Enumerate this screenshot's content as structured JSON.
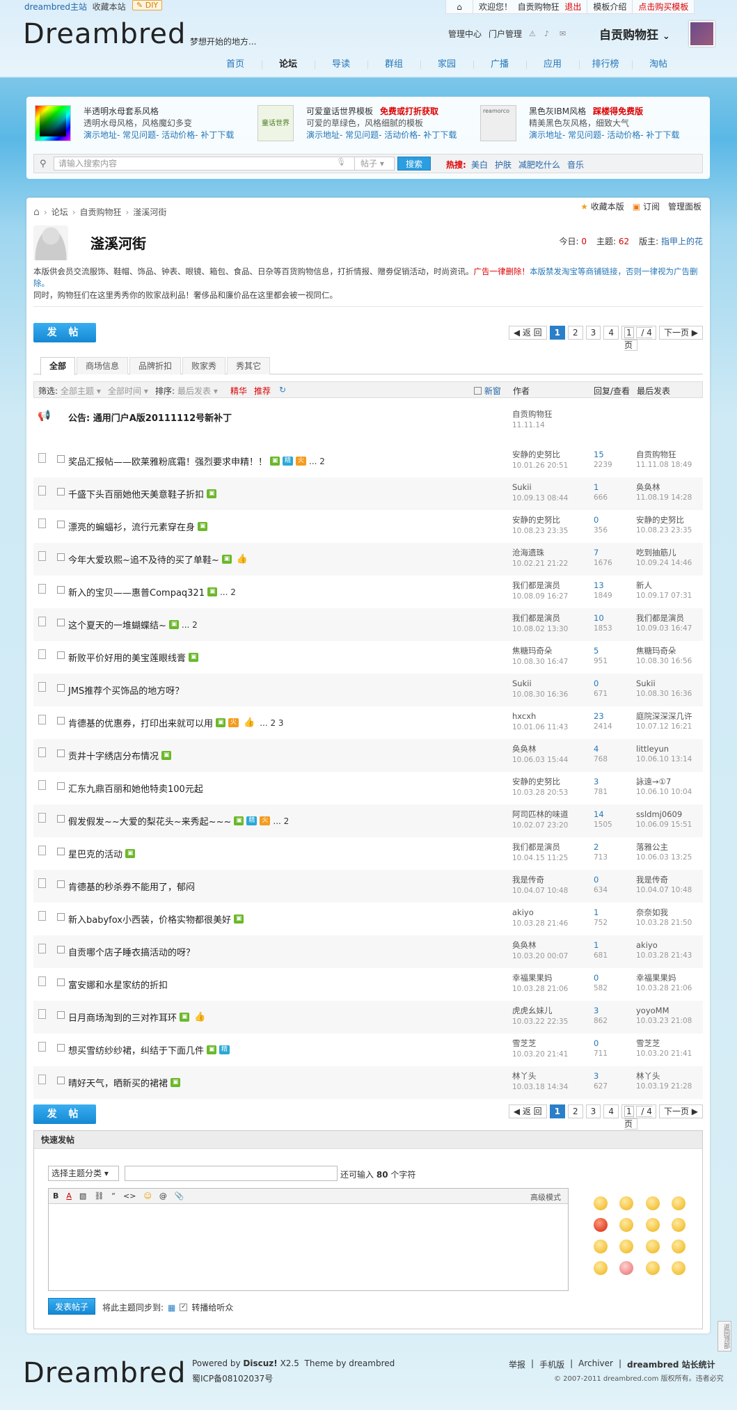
{
  "topbar": {
    "site": "dreambred主站",
    "fav": "收藏本站",
    "diy": "DIY",
    "welcome": "欢迎您！",
    "user": "自贡购物狂",
    "logout": "退出",
    "tpl": "模板介绍",
    "buy": "点击购买模板"
  },
  "header": {
    "logo": "Dreambred",
    "slogan": "梦想开始的地方...",
    "admin": "管理中心",
    "portal": "门户管理",
    "username": "自贡购物狂"
  },
  "nav": [
    "首页",
    "论坛",
    "导读",
    "群组",
    "家园",
    "广播",
    "应用",
    "排行榜",
    "淘帖"
  ],
  "promo": [
    {
      "title": "半透明水母套系风格",
      "tag": "",
      "desc": "透明水母风格，风格魔幻多变",
      "links": "演示地址- 常见问题- 活动价格- 补丁下载",
      "thumb_color": "#333"
    },
    {
      "title": "可爱童话世界模板",
      "tag": "免费或打折获取",
      "desc": "可爱的草绿色，风格细腻的模板",
      "links": "演示地址- 常见问题- 活动价格- 补丁下载",
      "thumb_color": "#9bc66b",
      "thumb_text": "童话世界"
    },
    {
      "title": "黑色灰IBM风格",
      "tag": "踩楼得免费版",
      "desc": "精美黑色灰风格，细致大气",
      "links": "演示地址- 常见问题- 活动价格- 补丁下载",
      "thumb_color": "#cfcfcf",
      "thumb_text": "reamorco"
    }
  ],
  "search": {
    "placeholder": "请输入搜索内容",
    "type": "帖子",
    "button": "搜索",
    "hot_label": "热搜:",
    "hot": [
      "美白",
      "护肤",
      "减肥吃什么",
      "音乐"
    ]
  },
  "breadcrumb": [
    "论坛",
    "自贡购物狂",
    "滏溪河街"
  ],
  "actions": {
    "fav": "收藏本版",
    "sub": "订阅",
    "manage": "管理面板"
  },
  "forum": {
    "title": "滏溪河街",
    "today_label": "今日:",
    "today": "0",
    "topics_label": "主题:",
    "topics": "62",
    "mod_label": "版主:",
    "mod": "指甲上的花",
    "desc1": "本版供会员交流服饰、鞋帽、饰品、钟表、眼镜、箱包、食品、日杂等百货购物信息，打折情报、赠劵促销活动，时尚资讯。",
    "desc_red": "广告一律删除！",
    "desc_blue": "本版禁发淘宝等商铺链接，否则一律视为广告删除。",
    "desc2": "同时，购物狂们在这里秀秀你的败家战利品！奢侈品和廉价品在这里都会被一视同仁。"
  },
  "post_button": "发 帖",
  "pager": {
    "back": "◀ 返 回",
    "pages": [
      "1",
      "2",
      "3",
      "4"
    ],
    "input": "1",
    "total": "/ 4 页",
    "next": "下一页 ▶"
  },
  "tabs": [
    "全部",
    "商场信息",
    "品牌折扣",
    "败家秀",
    "秀其它"
  ],
  "thead": {
    "filter": "筛选:",
    "all_topic": "全部主题 ▾",
    "all_time": "全部时间 ▾",
    "sort": "排序:",
    "latest": "最后发表 ▾",
    "jing": "精华",
    "rec": "推荐",
    "newwin": "新窗",
    "author": "作者",
    "rv": "回复/查看",
    "last": "最后发表"
  },
  "announce": {
    "title": "公告: 通用门户A版20111112号新补丁",
    "author": "自贡购物狂",
    "date": "11.11.14"
  },
  "threads": [
    {
      "title": "奖品汇报帖——欧莱雅粉底霜！强烈要求申精！！",
      "tags": [
        "img",
        "jing",
        "hot"
      ],
      "pages": "... 2",
      "author": "安静的史努比",
      "adate": "10.01.26 20:51",
      "replies": "15",
      "views": "2239",
      "last": "自贡购物狂",
      "ldate": "11.11.08 18:49"
    },
    {
      "title": "千盛下头百丽她他天美意鞋子折扣",
      "tags": [
        "img"
      ],
      "pages": "",
      "author": "Sukii",
      "adate": "10.09.13 08:44",
      "replies": "1",
      "views": "666",
      "last": "奂奂林",
      "ldate": "11.08.19 14:28"
    },
    {
      "title": "漂亮的蝙蝠衫，流行元素穿在身",
      "tags": [
        "img"
      ],
      "pages": "",
      "author": "安静的史努比",
      "adate": "10.08.23 23:35",
      "replies": "0",
      "views": "356",
      "last": "安静的史努比",
      "ldate": "10.08.23 23:35"
    },
    {
      "title": "今年大爱玖熙~追不及待的买了单鞋~",
      "tags": [
        "img",
        "zan"
      ],
      "pages": "",
      "author": "沧海遗珠",
      "adate": "10.02.21 21:22",
      "replies": "7",
      "views": "1676",
      "last": "吃到抽筋儿",
      "ldate": "10.09.24 14:46"
    },
    {
      "title": "新入的宝贝——惠普Compaq321",
      "tags": [
        "img"
      ],
      "pages": "... 2",
      "author": "我们都是演员",
      "adate": "10.08.09 16:27",
      "replies": "13",
      "views": "1849",
      "last": "新人",
      "ldate": "10.09.17 07:31"
    },
    {
      "title": "这个夏天的一堆蝴蝶结~",
      "tags": [
        "img"
      ],
      "pages": "... 2",
      "author": "我们都是演员",
      "adate": "10.08.02 13:30",
      "replies": "10",
      "views": "1853",
      "last": "我们都是演员",
      "ldate": "10.09.03 16:47"
    },
    {
      "title": "新败平价好用的美宝莲眼线膏",
      "tags": [
        "img"
      ],
      "pages": "",
      "author": "焦糖玛奇朵",
      "adate": "10.08.30 16:47",
      "replies": "5",
      "views": "951",
      "last": "焦糖玛奇朵",
      "ldate": "10.08.30 16:56"
    },
    {
      "title": "JMS推荐个买饰品的地方呀？",
      "tags": [],
      "pages": "",
      "author": "Sukii",
      "adate": "10.08.30 16:36",
      "replies": "0",
      "views": "671",
      "last": "Sukii",
      "ldate": "10.08.30 16:36"
    },
    {
      "title": "肯德基的优惠券，打印出来就可以用",
      "tags": [
        "img",
        "hot",
        "zan"
      ],
      "pages": "... 2  3",
      "author": "hxcxh",
      "adate": "10.01.06 11:43",
      "replies": "23",
      "views": "2414",
      "last": "庭院深深深几许",
      "ldate": "10.07.12 16:21"
    },
    {
      "title": "贡井十字绣店分布情况",
      "tags": [
        "img"
      ],
      "pages": "",
      "author": "奂奂林",
      "adate": "10.06.03 15:44",
      "replies": "4",
      "views": "768",
      "last": "littleyun",
      "ldate": "10.06.10 13:14"
    },
    {
      "title": "汇东九鼎百丽和她他特卖100元起",
      "tags": [],
      "pages": "",
      "author": "安静的史努比",
      "adate": "10.03.28 20:53",
      "replies": "3",
      "views": "781",
      "last": "詠遠→①7",
      "ldate": "10.06.10 10:04"
    },
    {
      "title": "假发假发~~大爱的梨花头~来秀起~~~",
      "tags": [
        "img",
        "jing",
        "hot"
      ],
      "pages": "... 2",
      "author": "阿司匹林的味道",
      "adate": "10.02.07 23:20",
      "replies": "14",
      "views": "1505",
      "last": "ssldmj0609",
      "ldate": "10.06.09 15:51"
    },
    {
      "title": "星巴克的活动",
      "tags": [
        "img"
      ],
      "pages": "",
      "author": "我们都是演员",
      "adate": "10.04.15 11:25",
      "replies": "2",
      "views": "713",
      "last": "落雅公主",
      "ldate": "10.06.03 13:25"
    },
    {
      "title": "肯德基的秒杀券不能用了，郁闷",
      "tags": [],
      "pages": "",
      "author": "我是传奇",
      "adate": "10.04.07 10:48",
      "replies": "0",
      "views": "634",
      "last": "我是传奇",
      "ldate": "10.04.07 10:48"
    },
    {
      "title": "新入babyfox小西装，价格实物都很美好",
      "tags": [
        "img"
      ],
      "pages": "",
      "author": "akiyo",
      "adate": "10.03.28 21:46",
      "replies": "1",
      "views": "752",
      "last": "奈奈如我",
      "ldate": "10.03.28 21:50"
    },
    {
      "title": "自贡哪个店子睡衣搞活动的呀？",
      "tags": [],
      "pages": "",
      "author": "奂奂林",
      "adate": "10.03.20 00:07",
      "replies": "1",
      "views": "681",
      "last": "akiyo",
      "ldate": "10.03.28 21:43"
    },
    {
      "title": "富安娜和水星家纺的折扣",
      "tags": [],
      "pages": "",
      "author": "幸福果果妈",
      "adate": "10.03.28 21:06",
      "replies": "0",
      "views": "582",
      "last": "幸福果果妈",
      "ldate": "10.03.28 21:06"
    },
    {
      "title": "日月商场淘到的三对祚耳环",
      "tags": [
        "img",
        "zan"
      ],
      "pages": "",
      "author": "虎虎幺妹儿",
      "adate": "10.03.22 22:35",
      "replies": "3",
      "views": "862",
      "last": "yoyoMM",
      "ldate": "10.03.23 21:08"
    },
    {
      "title": "想买雪纺纱纱裙，纠结于下面几件",
      "tags": [
        "img",
        "jing"
      ],
      "pages": "",
      "author": "雪芝芝",
      "adate": "10.03.20 21:41",
      "replies": "0",
      "views": "711",
      "last": "雪芝芝",
      "ldate": "10.03.20 21:41"
    },
    {
      "title": "晴好天气，晒新买的裙裙",
      "tags": [
        "img"
      ],
      "pages": "",
      "author": "林丫头",
      "adate": "10.03.18 14:34",
      "replies": "3",
      "views": "627",
      "last": "林丫头",
      "ldate": "10.03.19 21:28"
    }
  ],
  "quick": {
    "title": "快速发帖",
    "sel": "选择主题分类 ▾",
    "hint1": "还可输入",
    "hint_num": "80",
    "hint2": "个字符",
    "adv": "高级模式",
    "submit": "发表帖子",
    "sync": "将此主题同步到:",
    "relay": "转播给听众"
  },
  "footer": {
    "logo": "Dreambred",
    "powered": "Powered by",
    "discuz": "Discuz!",
    "ver": "X2.5",
    "theme": "Theme by dreambred",
    "icp": "蜀ICP备08102037号",
    "links": [
      "举报",
      "手机版",
      "Archiver",
      "dreambred 站长统计"
    ],
    "copy": "© 2007-2011 dreambred.com 版权所有。违者必究",
    "totop": "返回顶部"
  }
}
